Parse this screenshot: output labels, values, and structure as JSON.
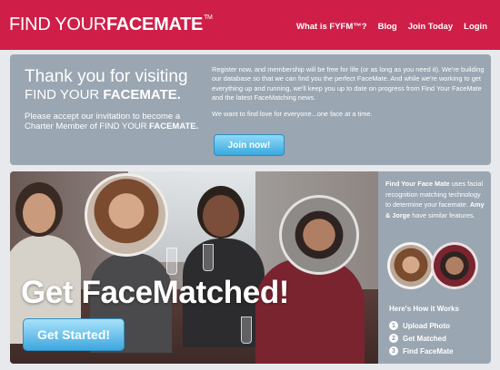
{
  "header": {
    "logo_light": "FIND YOUR",
    "logo_bold": "FACEMATE",
    "logo_tm": "TM",
    "nav": [
      "What is FYFM™?",
      "Blog",
      "Join Today",
      "Login"
    ]
  },
  "welcome": {
    "line1": "Thank you for visiting",
    "line2_light": "FIND YOUR",
    "line2_bold": "FACEMATE.",
    "invite_text": "Please accept our invitation to become a Charter Member of FIND YOUR",
    "invite_bold": "FACEMATE.",
    "paragraph1": "Register now, and membership will be free for life (or as long as you need it). We're building our database so that we can find you the perfect FaceMate. And while we're working to get everything up and running, we'll keep you up to date on progress from Find Your FaceMate and the latest FaceMatching news.",
    "paragraph2": "We want to find love for everyone...one face at a time.",
    "join_button": "Join now!"
  },
  "hero": {
    "title": "Get FaceMatched!",
    "start_button": "Get Started!"
  },
  "sidebar": {
    "brand": "Find Your Face Mate",
    "text1": "uses facial recognition matching technology to determine your facemate.",
    "names": "Amy & Jorge",
    "text2": "have similar features.",
    "how_title": "Here's How it Works",
    "steps": [
      {
        "num": "1",
        "label": "Upload Photo"
      },
      {
        "num": "2",
        "label": "Get Matched"
      },
      {
        "num": "3",
        "label": "Find FaceMate"
      }
    ]
  },
  "colors": {
    "header_bg": "#cf1f49",
    "panel_bg": "#9aa6b2",
    "button_blue": "#3aa8dd"
  }
}
